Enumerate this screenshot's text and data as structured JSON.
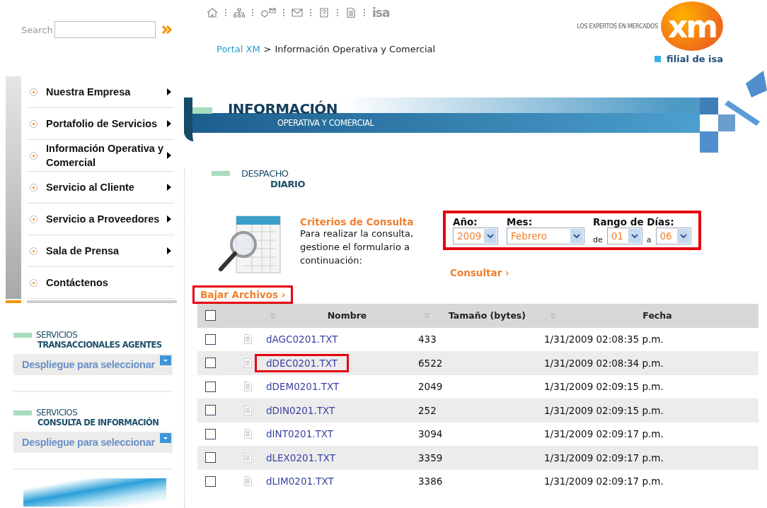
{
  "search": {
    "label": "Search"
  },
  "toolbar": {
    "logo_text": "isa"
  },
  "breadcrumb": {
    "link": "Portal XM",
    "separator": ">",
    "current": "Información Operativa y Comercial"
  },
  "brand": {
    "tagline": "LOS EXPERTOS EN MERCADOS",
    "mark": "xm",
    "subtitle": "filial de isa"
  },
  "sidebar": {
    "items": [
      {
        "label": "Nuestra Empresa",
        "has_submenu": true
      },
      {
        "label": "Portafolio de Servicios",
        "has_submenu": true
      },
      {
        "label": "Información Operativa y Comercial",
        "has_submenu": true
      },
      {
        "label": "Servicio al Cliente",
        "has_submenu": true
      },
      {
        "label": "Servicio a Proveedores",
        "has_submenu": true
      },
      {
        "label": "Sala de Prensa",
        "has_submenu": true
      },
      {
        "label": "Contáctenos",
        "has_submenu": false
      }
    ],
    "services": [
      {
        "title": "SERVICIOS",
        "subtitle": "TRANSACCIONALES AGENTES",
        "dropdown": "Despliegue para seleccionar"
      },
      {
        "title": "SERVICIOS",
        "subtitle": "CONSULTA DE INFORMACIÓN",
        "dropdown": "Despliegue para seleccionar"
      }
    ]
  },
  "banner": {
    "title": "INFORMACIÓN",
    "subtitle": "OPERATIVA Y COMERCIAL"
  },
  "section": {
    "title": "DESPACHO",
    "subtitle": "DIARIO"
  },
  "criteria": {
    "title": "Criterios de Consulta",
    "text": "Para realizar la consulta, gestione el formulario a continuación:"
  },
  "filters": {
    "highlighted": true,
    "year": {
      "label": "Año:",
      "value": "2009"
    },
    "month": {
      "label": "Mes:",
      "value": "Febrero"
    },
    "range": {
      "label": "Rango de Días:",
      "from_label": "de",
      "from": "01",
      "to_label": "a",
      "to": "06"
    }
  },
  "consult_link": {
    "label": "Consultar",
    "chevron": "›"
  },
  "download_link": {
    "label": "Bajar Archivos",
    "chevron": "›",
    "highlighted": true
  },
  "table": {
    "header_checked": false,
    "columns": [
      "Nombre",
      "Tamaño (bytes)",
      "Fecha"
    ],
    "rows": [
      {
        "checked": false,
        "name": "dAGC0201.TXT",
        "size": "433",
        "date": "1/31/2009 02:08:35 p.m.",
        "highlighted": false
      },
      {
        "checked": false,
        "name": "dDEC0201.TXT",
        "size": "6522",
        "date": "1/31/2009 02:08:34 p.m.",
        "highlighted": true
      },
      {
        "checked": false,
        "name": "dDEM0201.TXT",
        "size": "2049",
        "date": "1/31/2009 02:09:15 p.m.",
        "highlighted": false
      },
      {
        "checked": false,
        "name": "dDIN0201.TXT",
        "size": "252",
        "date": "1/31/2009 02:09:15 p.m.",
        "highlighted": false
      },
      {
        "checked": false,
        "name": "dINT0201.TXT",
        "size": "3094",
        "date": "1/31/2009 02:09:17 p.m.",
        "highlighted": false
      },
      {
        "checked": false,
        "name": "dLEX0201.TXT",
        "size": "3359",
        "date": "1/31/2009 02:09:17 p.m.",
        "highlighted": false
      },
      {
        "checked": false,
        "name": "dLIM0201.TXT",
        "size": "3386",
        "date": "1/31/2009 02:09:17 p.m.",
        "highlighted": false
      }
    ]
  }
}
